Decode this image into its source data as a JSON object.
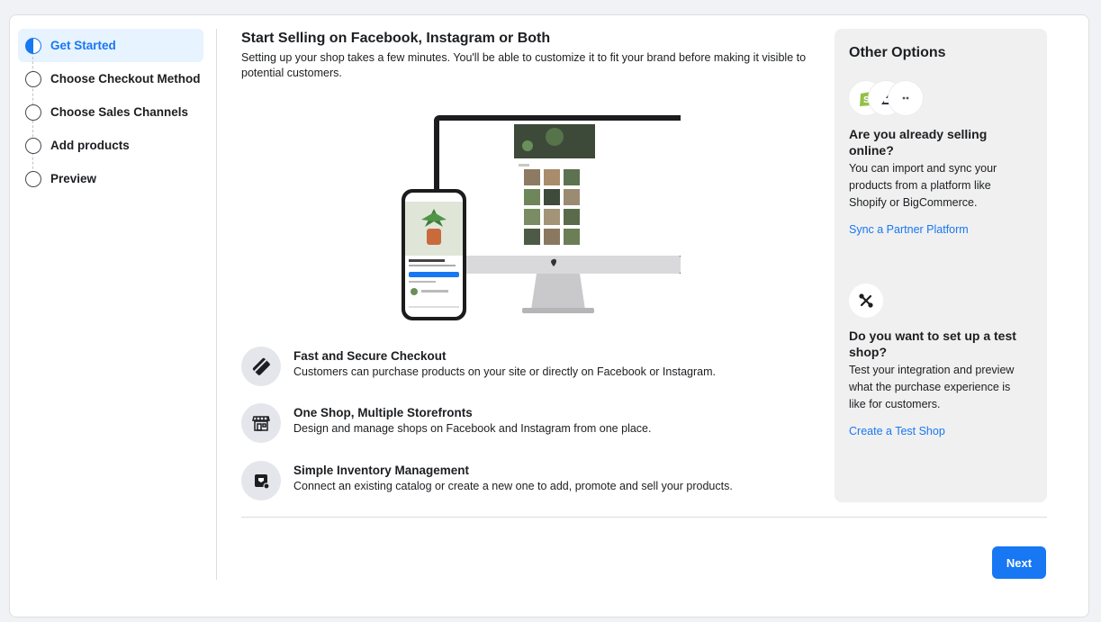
{
  "steps": [
    {
      "label": "Get Started",
      "state": "in-progress"
    },
    {
      "label": "Choose Checkout Method",
      "state": "todo"
    },
    {
      "label": "Choose Sales Channels",
      "state": "todo"
    },
    {
      "label": "Add products",
      "state": "todo"
    },
    {
      "label": "Preview",
      "state": "todo"
    }
  ],
  "main": {
    "title": "Start Selling on Facebook, Instagram or Both",
    "subtitle": "Setting up your shop takes a few minutes. You'll be able to customize it to fit your brand before making it visible to potential customers.",
    "features": [
      {
        "icon": "card-icon",
        "title": "Fast and Secure Checkout",
        "desc": "Customers can purchase products on your site or directly on Facebook or Instagram."
      },
      {
        "icon": "storefront-icon",
        "title": "One Shop, Multiple Storefronts",
        "desc": "Design and manage shops on Facebook and Instagram from one place."
      },
      {
        "icon": "inventory-icon",
        "title": "Simple Inventory Management",
        "desc": "Connect an existing catalog or create a new one to add, promote and sell your products."
      }
    ]
  },
  "panel": {
    "title": "Other Options",
    "selling_q": "Are you already selling online?",
    "selling_desc": "You can import and sync your products from a platform like Shopify or BigCommerce.",
    "selling_link": "Sync a Partner Platform",
    "test_q": "Do you want to set up a test shop?",
    "test_desc": "Test your integration and preview what the purchase experience is like for customers.",
    "test_link": "Create a Test Shop"
  },
  "footer": {
    "next_label": "Next"
  },
  "colors": {
    "accent": "#1877f2",
    "active_bg": "#e7f3ff",
    "panel_bg": "#f0f0f0",
    "shopify": "#95bf47"
  }
}
